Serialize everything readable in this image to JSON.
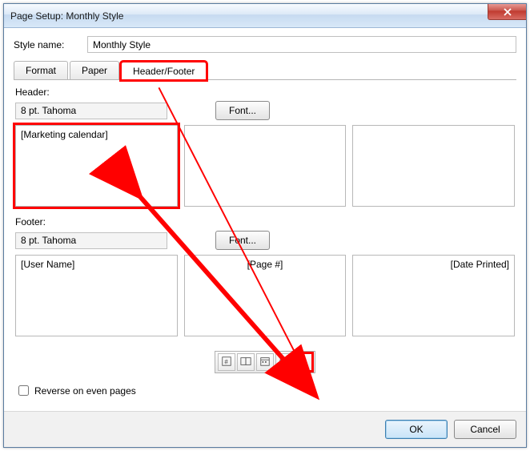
{
  "window": {
    "title": "Page Setup: Monthly Style"
  },
  "style": {
    "label": "Style name:",
    "value": "Monthly Style"
  },
  "tabs": {
    "format": "Format",
    "paper": "Paper",
    "headerfooter": "Header/Footer"
  },
  "header": {
    "label": "Header:",
    "font_text": "8 pt. Tahoma",
    "font_button": "Font...",
    "left": "[Marketing calendar]",
    "center": "",
    "right": ""
  },
  "footer": {
    "label": "Footer:",
    "font_text": "8 pt. Tahoma",
    "font_button": "Font...",
    "left": "[User Name]",
    "center": "[Page #]",
    "right": "[Date Printed]"
  },
  "toolbar": {
    "icons": [
      "page-number-icon",
      "total-pages-icon",
      "date-icon",
      "time-icon",
      "user-icon"
    ]
  },
  "checkbox": {
    "label": "Reverse on even pages"
  },
  "buttons": {
    "ok": "OK",
    "cancel": "Cancel"
  }
}
